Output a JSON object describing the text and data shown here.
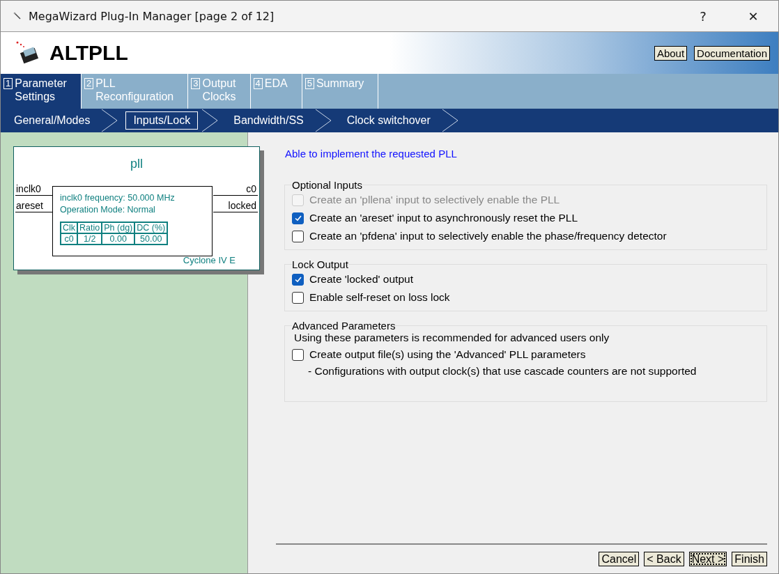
{
  "window": {
    "title": "MegaWizard Plug-In Manager [page 2 of 12]",
    "help": "?",
    "close": "✕"
  },
  "header": {
    "title": "ALTPLL",
    "buttons": [
      "About",
      "Documentation"
    ]
  },
  "tabs": [
    {
      "number": "1",
      "label": "Parameter Settings",
      "selected": true
    },
    {
      "number": "2",
      "label": "PLL Reconfiguration",
      "selected": false
    },
    {
      "number": "3",
      "label": "Output Clocks",
      "selected": false
    },
    {
      "number": "4",
      "label": "EDA",
      "selected": false
    },
    {
      "number": "5",
      "label": "Summary",
      "selected": false
    }
  ],
  "subtabs": [
    {
      "label": "General/Modes",
      "selected": false
    },
    {
      "label": "Inputs/Lock",
      "selected": true
    },
    {
      "label": "Bandwidth/SS",
      "selected": false
    },
    {
      "label": "Clock switchover",
      "selected": false
    }
  ],
  "diagram": {
    "name": "pll",
    "inputs": [
      "inclk0",
      "areset"
    ],
    "outputs": [
      "c0",
      "locked"
    ],
    "info": [
      "inclk0 frequency: 50.000 MHz",
      "Operation Mode: Normal"
    ],
    "table": {
      "columns": [
        "Clk",
        "Ratio",
        "Ph (dg)",
        "DC (%)"
      ],
      "rows": [
        [
          "c0",
          "1/2",
          "0.00",
          "50.00"
        ]
      ]
    },
    "device": "Cyclone IV E"
  },
  "status": "Able to implement the requested PLL",
  "groups": [
    {
      "title": "Optional Inputs",
      "items": [
        {
          "kind": "checkbox",
          "label": "Create an 'pllena' input to selectively enable the PLL",
          "checked": false,
          "disabled": true
        },
        {
          "kind": "checkbox",
          "label": "Create an 'areset' input to asynchronously reset the PLL",
          "checked": true,
          "disabled": false
        },
        {
          "kind": "checkbox",
          "label": "Create an 'pfdena' input to selectively enable the phase/frequency detector",
          "checked": false,
          "disabled": false
        }
      ]
    },
    {
      "title": "Lock Output",
      "items": [
        {
          "kind": "checkbox",
          "label": "Create 'locked' output",
          "checked": true,
          "disabled": false
        },
        {
          "kind": "checkbox",
          "label": "Enable self-reset on loss lock",
          "checked": false,
          "disabled": false
        }
      ]
    },
    {
      "title": "Advanced Parameters",
      "items": [
        {
          "kind": "text",
          "label": "Using these parameters is recommended for advanced users only"
        },
        {
          "kind": "checkbox",
          "label": "Create output file(s) using the 'Advanced' PLL parameters",
          "checked": false,
          "disabled": false
        },
        {
          "kind": "note",
          "label": "- Configurations with output clock(s) that use cascade counters are not supported"
        }
      ]
    }
  ],
  "buttons": [
    {
      "label": "Cancel",
      "focused": false
    },
    {
      "label": "< Back",
      "focused": false
    },
    {
      "label": "Next >",
      "focused": true
    },
    {
      "label": "Finish",
      "focused": false
    }
  ]
}
